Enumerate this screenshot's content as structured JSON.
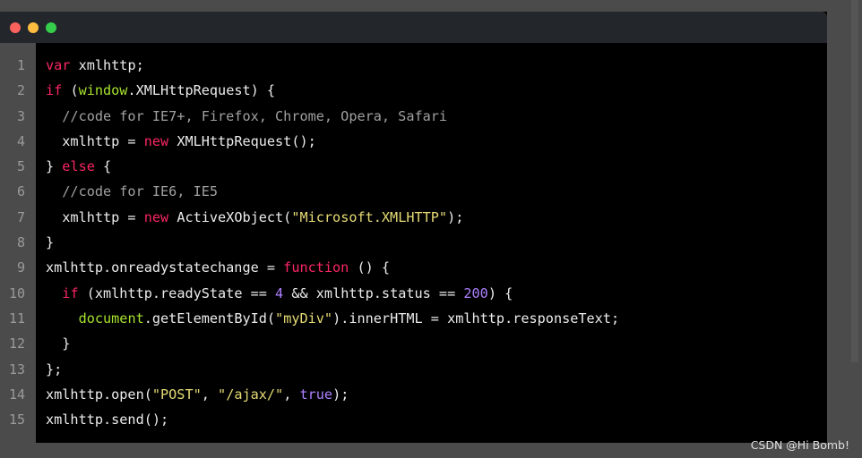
{
  "window": {
    "dots": [
      {
        "name": "close-dot",
        "color": "#fc625d"
      },
      {
        "name": "minimize-dot",
        "color": "#fdbc40"
      },
      {
        "name": "maximize-dot",
        "color": "#35cd4b"
      }
    ]
  },
  "code": {
    "line_numbers": [
      "1",
      "2",
      "3",
      "4",
      "5",
      "6",
      "7",
      "8",
      "9",
      "10",
      "11",
      "12",
      "13",
      "14",
      "15"
    ],
    "lines": [
      [
        {
          "t": "var",
          "c": "kw"
        },
        {
          "t": " xmlhttp;",
          "c": "plain"
        }
      ],
      [
        {
          "t": "if",
          "c": "kw"
        },
        {
          "t": " (",
          "c": "plain"
        },
        {
          "t": "window",
          "c": "fn"
        },
        {
          "t": ".XMLHttpRequest) {",
          "c": "plain"
        }
      ],
      [
        {
          "t": "  //code for IE7+, Firefox, Chrome, Opera, Safari",
          "c": "cm"
        }
      ],
      [
        {
          "t": "  xmlhttp = ",
          "c": "plain"
        },
        {
          "t": "new",
          "c": "kw"
        },
        {
          "t": " XMLHttpRequest();",
          "c": "plain"
        }
      ],
      [
        {
          "t": "} ",
          "c": "plain"
        },
        {
          "t": "else",
          "c": "kw"
        },
        {
          "t": " {",
          "c": "plain"
        }
      ],
      [
        {
          "t": "  //code for IE6, IE5",
          "c": "cm"
        }
      ],
      [
        {
          "t": "  xmlhttp = ",
          "c": "plain"
        },
        {
          "t": "new",
          "c": "kw"
        },
        {
          "t": " ActiveXObject(",
          "c": "plain"
        },
        {
          "t": "\"Microsoft.XMLHTTP\"",
          "c": "str"
        },
        {
          "t": ");",
          "c": "plain"
        }
      ],
      [
        {
          "t": "}",
          "c": "plain"
        }
      ],
      [
        {
          "t": "xmlhttp.onreadystatechange = ",
          "c": "plain"
        },
        {
          "t": "function",
          "c": "kw"
        },
        {
          "t": " () {",
          "c": "plain"
        }
      ],
      [
        {
          "t": "  ",
          "c": "plain"
        },
        {
          "t": "if",
          "c": "kw"
        },
        {
          "t": " (xmlhttp.readyState == ",
          "c": "plain"
        },
        {
          "t": "4",
          "c": "num"
        },
        {
          "t": " && xmlhttp.status == ",
          "c": "plain"
        },
        {
          "t": "200",
          "c": "num"
        },
        {
          "t": ") {",
          "c": "plain"
        }
      ],
      [
        {
          "t": "    ",
          "c": "plain"
        },
        {
          "t": "document",
          "c": "fn"
        },
        {
          "t": ".getElementById(",
          "c": "plain"
        },
        {
          "t": "\"myDiv\"",
          "c": "str"
        },
        {
          "t": ").innerHTML = xmlhttp.responseText;",
          "c": "plain"
        }
      ],
      [
        {
          "t": "  }",
          "c": "plain"
        }
      ],
      [
        {
          "t": "};",
          "c": "plain"
        }
      ],
      [
        {
          "t": "xmlhttp.open(",
          "c": "plain"
        },
        {
          "t": "\"POST\"",
          "c": "str"
        },
        {
          "t": ", ",
          "c": "plain"
        },
        {
          "t": "\"/ajax/\"",
          "c": "str"
        },
        {
          "t": ", ",
          "c": "plain"
        },
        {
          "t": "true",
          "c": "num"
        },
        {
          "t": ");",
          "c": "plain"
        }
      ],
      [
        {
          "t": "xmlhttp.send();",
          "c": "plain"
        }
      ]
    ]
  },
  "watermark": "CSDN @Hi Bomb!"
}
